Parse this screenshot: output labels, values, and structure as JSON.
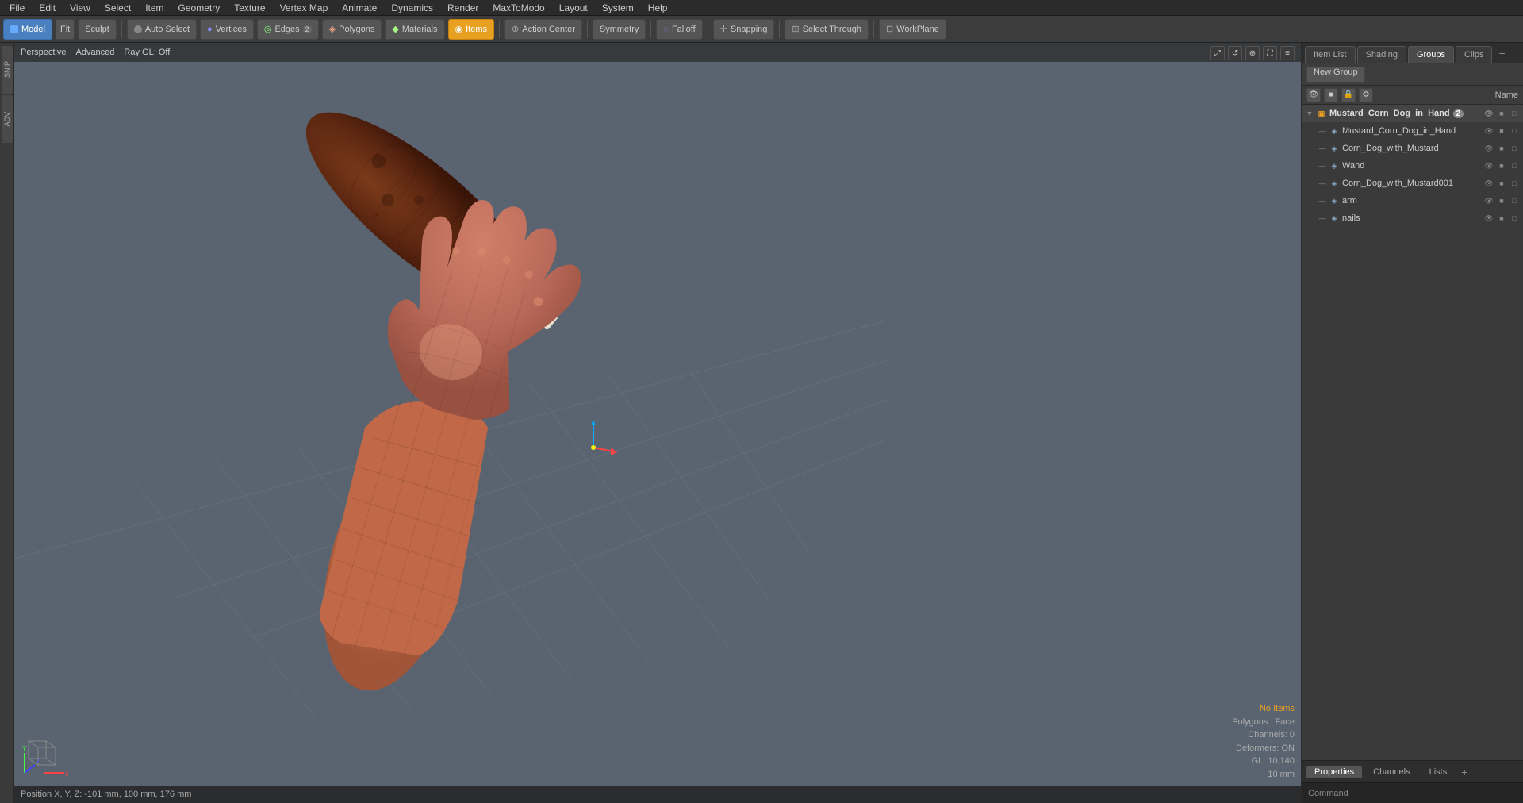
{
  "menubar": {
    "items": [
      "File",
      "Edit",
      "View",
      "Select",
      "Item",
      "Geometry",
      "Texture",
      "Vertex Map",
      "Animate",
      "Dynamics",
      "Render",
      "MaxToModo",
      "Layout",
      "System",
      "Help"
    ]
  },
  "toolbar": {
    "mode_model": "Model",
    "mode_fit": "Fit",
    "mode_sculpt": "Sculpt",
    "auto_select": "Auto Select",
    "btn_vertices": "Vertices",
    "btn_edges": "Edges",
    "btn_polygons": "Polygons",
    "btn_materials": "Materials",
    "btn_items": "Items",
    "btn_action_center": "Action Center",
    "btn_symmetry": "Symmetry",
    "btn_falloff": "Falloff",
    "btn_snapping": "Snapping",
    "btn_select_through": "Select Through",
    "btn_workplane": "WorkPlane",
    "edges_count": "2"
  },
  "viewport": {
    "label_perspective": "Perspective",
    "label_advanced": "Advanced",
    "label_raygl": "Ray GL: Off",
    "status_text": "Position X, Y, Z:  -101 mm, 100 mm, 176 mm"
  },
  "viewport_info": {
    "no_items": "No Items",
    "polygons": "Polygons : Face",
    "channels": "Channels: 0",
    "deformers": "Deformers: ON",
    "gl": "GL: 10,140",
    "size": "10 mm"
  },
  "right_panel": {
    "tabs": [
      "Item List",
      "Shading",
      "Groups",
      "Clips"
    ],
    "active_tab": "Groups",
    "add_tab": "+",
    "new_group_btn": "New Group",
    "col_header": "Name",
    "row_icons": [
      "eye",
      "render",
      "lock",
      "settings"
    ],
    "tree": {
      "root": {
        "name": "Mustard_Corn_Dog_in_Hand",
        "badge": "2",
        "expanded": true,
        "children": [
          {
            "name": "Mustard_Corn_Dog_in_Hand",
            "indent": 1,
            "icon": "mesh",
            "selected": false
          },
          {
            "name": "Corn_Dog_with_Mustard",
            "indent": 1,
            "icon": "mesh",
            "selected": false
          },
          {
            "name": "Wand",
            "indent": 1,
            "icon": "mesh",
            "selected": false
          },
          {
            "name": "Corn_Dog_with_Mustard001",
            "indent": 1,
            "icon": "mesh",
            "selected": false
          },
          {
            "name": "arm",
            "indent": 1,
            "icon": "mesh",
            "selected": false
          },
          {
            "name": "nails",
            "indent": 1,
            "icon": "mesh",
            "selected": false
          }
        ]
      }
    }
  },
  "bottom_right": {
    "tabs": [
      "Properties",
      "Channels",
      "Lists"
    ],
    "add": "+"
  },
  "command_bar": {
    "label": "Command",
    "placeholder": ""
  },
  "icons": {
    "eye": "👁",
    "render": "■",
    "lock": "🔒",
    "gear": "⚙",
    "triangle_down": "▼",
    "triangle_right": "▶",
    "chevron_right": "›",
    "collapse": "◀"
  }
}
